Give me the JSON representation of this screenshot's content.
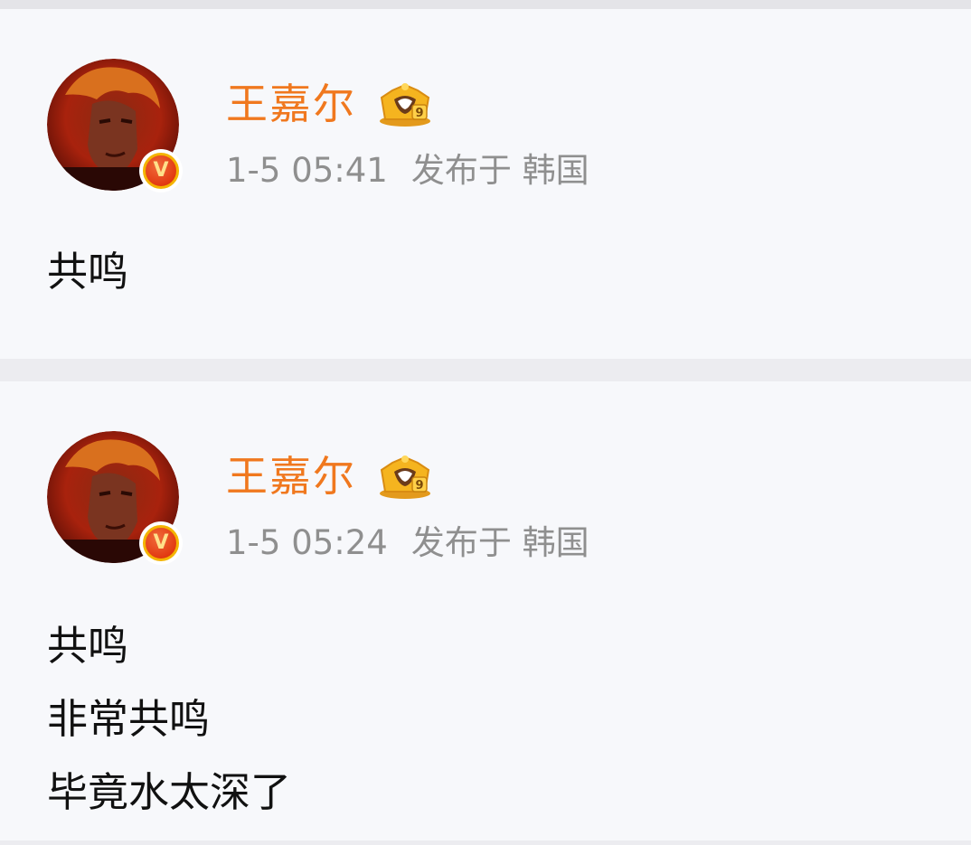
{
  "posts": [
    {
      "author": "王嘉尔",
      "date": "1-5 05:41",
      "location": "发布于 韩国",
      "verify_mark": "V",
      "vip_level": "9",
      "lines": [
        "共鸣"
      ]
    },
    {
      "author": "王嘉尔",
      "date": "1-5 05:24",
      "location": "发布于 韩国",
      "verify_mark": "V",
      "vip_level": "9",
      "lines": [
        "共鸣",
        "非常共鸣",
        "毕竟水太深了"
      ]
    }
  ],
  "colors": {
    "author_name": "#f0781e",
    "meta_text": "#8f8f8f",
    "post_text": "#111111",
    "card_bg": "#f7f8fb",
    "separator": "#ececf0"
  },
  "icons": {
    "verify": "verified-badge-icon",
    "vip": "crown-vip-icon"
  }
}
